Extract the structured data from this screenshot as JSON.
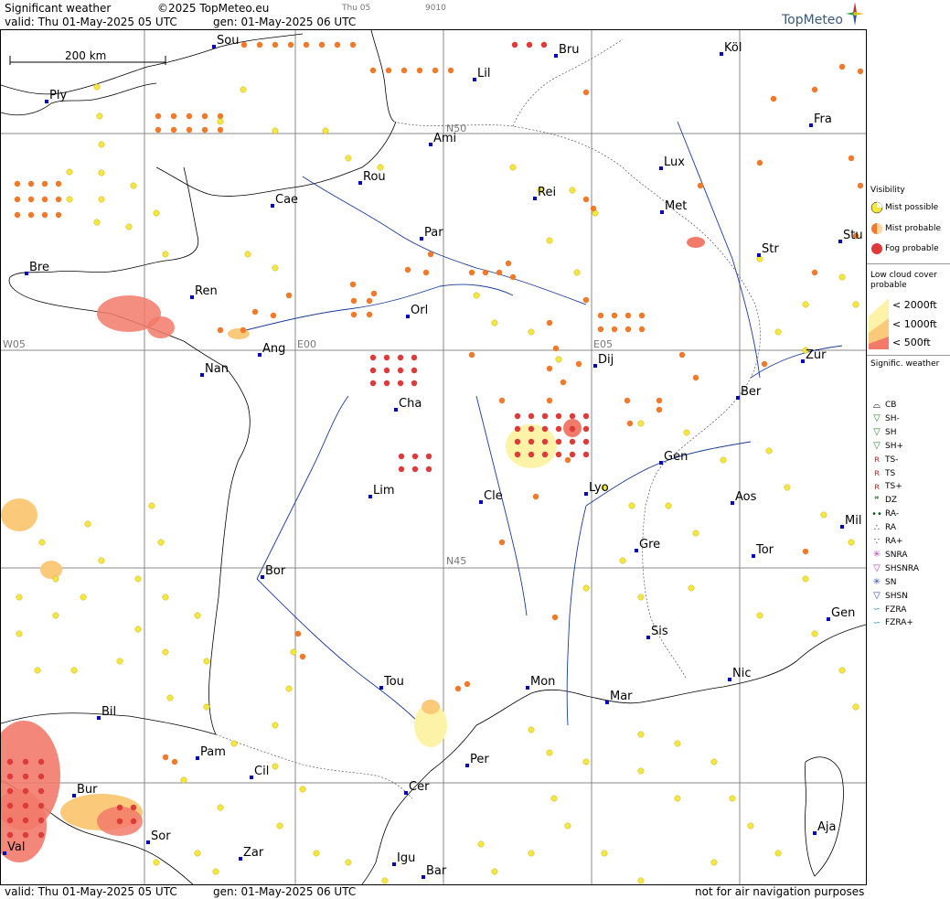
{
  "header": {
    "title": "Significant weather",
    "copyright": "©2025 TopMeteo.eu",
    "valid": "valid:  Thu  01-May-2025  05 UTC",
    "gen": "gen:  01-May-2025  06 UTC",
    "small_day": "Thu 05",
    "small_code": "9010",
    "logo": "TopMeteo"
  },
  "footer": {
    "valid": "valid:  Thu  01-May-2025  05 UTC",
    "gen": "gen:  01-May-2025  06 UTC",
    "disclaimer": "not for air navigation purposes"
  },
  "map": {
    "scale_label": "200 km",
    "grid_labels": [
      "N50",
      "N45",
      "W05",
      "E00",
      "E05"
    ],
    "cities": [
      {
        "name": "Sou"
      },
      {
        "name": "Bru"
      },
      {
        "name": "Köl"
      },
      {
        "name": "Ply"
      },
      {
        "name": "Lil"
      },
      {
        "name": "Ami"
      },
      {
        "name": "Fra"
      },
      {
        "name": "Lux"
      },
      {
        "name": "Rou"
      },
      {
        "name": "Cae"
      },
      {
        "name": "Rei"
      },
      {
        "name": "Met"
      },
      {
        "name": "Par"
      },
      {
        "name": "Stu"
      },
      {
        "name": "Str"
      },
      {
        "name": "Bre"
      },
      {
        "name": "Ren"
      },
      {
        "name": "Orl"
      },
      {
        "name": "Ang"
      },
      {
        "name": "Nan"
      },
      {
        "name": "Dij"
      },
      {
        "name": "Zür"
      },
      {
        "name": "Ber"
      },
      {
        "name": "Cha"
      },
      {
        "name": "Gen"
      },
      {
        "name": "Lim"
      },
      {
        "name": "Cle"
      },
      {
        "name": "Lyo"
      },
      {
        "name": "Aos"
      },
      {
        "name": "Mil"
      },
      {
        "name": "Gre"
      },
      {
        "name": "Tor"
      },
      {
        "name": "Bor"
      },
      {
        "name": "Gen"
      },
      {
        "name": "Sis"
      },
      {
        "name": "Tou"
      },
      {
        "name": "Mon"
      },
      {
        "name": "Nic"
      },
      {
        "name": "Mar"
      },
      {
        "name": "Bil"
      },
      {
        "name": "Pam"
      },
      {
        "name": "Cil"
      },
      {
        "name": "Per"
      },
      {
        "name": "Bur"
      },
      {
        "name": "Cer"
      },
      {
        "name": "Sor"
      },
      {
        "name": "Aja"
      },
      {
        "name": "Val"
      },
      {
        "name": "Zar"
      },
      {
        "name": "Igu"
      },
      {
        "name": "Bar"
      }
    ]
  },
  "legend": {
    "visibility_title": "Visibility",
    "visibility": [
      "Mist possible",
      "Mist probable",
      "Fog probable"
    ],
    "lowcloud_title": "Low cloud cover probable",
    "lowcloud": [
      "< 2000ft",
      "< 1000ft",
      "<   500ft"
    ],
    "signific_title": "Signific. weather",
    "signific": [
      "CB",
      "SH-",
      "SH",
      "SH+",
      "TS-",
      "TS",
      "TS+",
      "DZ",
      "RA-",
      "RA",
      "RA+",
      "SNRA",
      "SHSNRA",
      "SN",
      "SHSN",
      "FZRA",
      "FZRA+"
    ],
    "colors": {
      "mist_possible": "#f5e642",
      "mist_probable": "#f07a2a",
      "fog_probable": "#dd3a3a",
      "lowcloud_2000": "#fdf3a8",
      "lowcloud_1000": "#fbc97a",
      "lowcloud_500": "#f27a6a",
      "city_dot": "#0000c0",
      "river": "#1a3a9a"
    }
  }
}
